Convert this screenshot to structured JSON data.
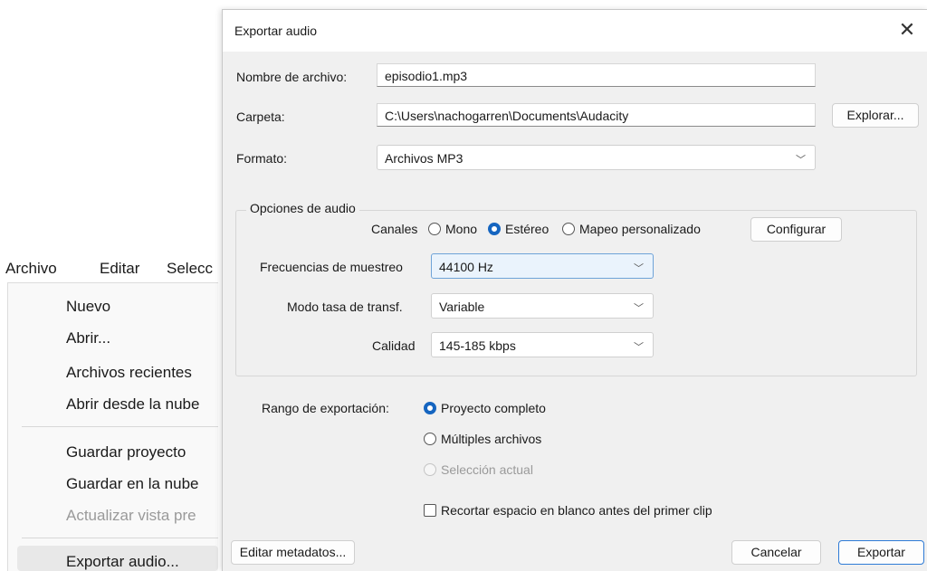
{
  "menubar": {
    "items": [
      "Archivo",
      "Editar",
      "Selecc"
    ]
  },
  "menu": {
    "items": [
      {
        "label": "Nuevo",
        "enabled": true
      },
      {
        "label": "Abrir...",
        "enabled": true
      },
      {
        "label": "Archivos recientes",
        "enabled": true
      },
      {
        "label": "Abrir desde la nube",
        "enabled": true
      },
      {
        "label": "Guardar proyecto",
        "enabled": true
      },
      {
        "label": "Guardar en la nube",
        "enabled": true
      },
      {
        "label": "Actualizar vista pre",
        "enabled": false
      },
      {
        "label": "Exportar audio...",
        "enabled": true,
        "highlighted": true
      }
    ]
  },
  "dialog": {
    "title": "Exportar audio",
    "close_glyph": "✕",
    "filename": {
      "label": "Nombre de archivo:",
      "value": "episodio1.mp3"
    },
    "folder": {
      "label": "Carpeta:",
      "value": "C:\\Users\\nachogarren\\Documents\\Audacity",
      "browse_label": "Explorar..."
    },
    "format": {
      "label": "Formato:",
      "value": "Archivos MP3"
    },
    "audio_options": {
      "title": "Opciones de audio",
      "channels_label": "Canales",
      "channels": [
        {
          "label": "Mono",
          "selected": false
        },
        {
          "label": "Estéreo",
          "selected": true
        },
        {
          "label": "Mapeo personalizado",
          "selected": false
        }
      ],
      "configure_label": "Configurar",
      "sample_rate": {
        "label": "Frecuencias de muestreo",
        "value": "44100 Hz"
      },
      "bitrate_mode": {
        "label": "Modo tasa de transf.",
        "value": "Variable"
      },
      "quality": {
        "label": "Calidad",
        "value": "145-185 kbps"
      }
    },
    "export_range": {
      "label": "Rango de exportación:",
      "options": [
        {
          "label": "Proyecto completo",
          "selected": true,
          "enabled": true
        },
        {
          "label": "Múltiples archivos",
          "selected": false,
          "enabled": true
        },
        {
          "label": "Selección actual",
          "selected": false,
          "enabled": false
        }
      ]
    },
    "trim_checkbox": {
      "label": "Recortar espacio en blanco antes del primer clip",
      "checked": false
    },
    "buttons": {
      "edit_metadata": "Editar metadatos...",
      "cancel": "Cancelar",
      "export": "Exportar"
    },
    "chevron_glyph": "﹀"
  },
  "colors": {
    "accent": "#1565c0",
    "dialog_bg": "#f0f0f0",
    "default_button_border": "#2e7bd6"
  }
}
